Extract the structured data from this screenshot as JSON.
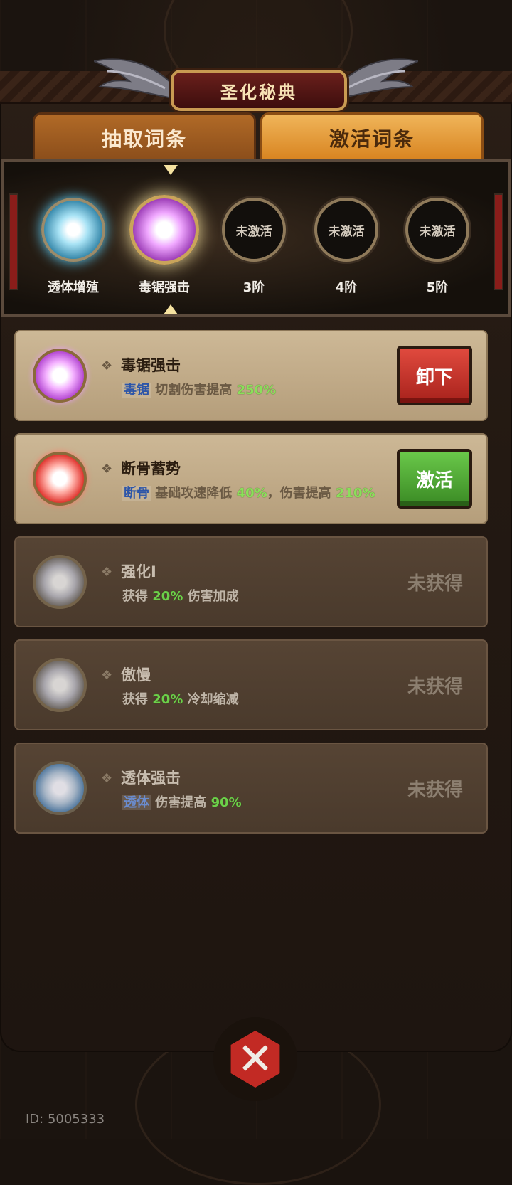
{
  "title": "圣化秘典",
  "tabs": [
    {
      "label": "抽取词条",
      "active": false
    },
    {
      "label": "激活词条",
      "active": true
    }
  ],
  "slots": [
    {
      "label": "透体增殖",
      "state": "cyan-orb",
      "inner_text": ""
    },
    {
      "label": "毒锯强击",
      "state": "purple-orb",
      "inner_text": ""
    },
    {
      "label": "3阶",
      "state": "empty",
      "inner_text": "未激活"
    },
    {
      "label": "4阶",
      "state": "empty",
      "inner_text": "未激活"
    },
    {
      "label": "5阶",
      "state": "empty",
      "inner_text": "未激活"
    }
  ],
  "cards": [
    {
      "name": "毒锯强击",
      "orb": "purple",
      "tag": "毒锯",
      "text1": "切割伤害提高",
      "val1": "250%",
      "text2": "",
      "val2": "",
      "action": "卸下",
      "action_style": "red"
    },
    {
      "name": "断骨蓄势",
      "orb": "red",
      "tag": "断骨",
      "text1": "基础攻速降低",
      "val1": "40%",
      "text2": "，伤害提高",
      "val2": "210%",
      "action": "激活",
      "action_style": "green"
    },
    {
      "name": "强化I",
      "orb": "gray",
      "tag": "",
      "text0": "获得",
      "val1": "20%",
      "text1": "伤害加成",
      "status": "未获得"
    },
    {
      "name": "傲慢",
      "orb": "gray",
      "tag": "",
      "text0": "获得",
      "val1": "20%",
      "text1": "冷却缩减",
      "status": "未获得"
    },
    {
      "name": "透体强击",
      "orb": "blue",
      "tag": "透体",
      "text1": "伤害提高",
      "val1": "90%",
      "status": "未获得"
    }
  ],
  "close_icon": "close-x-icon",
  "id_text": "ID: 5005333",
  "colors": {
    "accent_red": "#c22a24",
    "green_value": "#8ae05a",
    "tag_blue": "#2d55a8"
  }
}
